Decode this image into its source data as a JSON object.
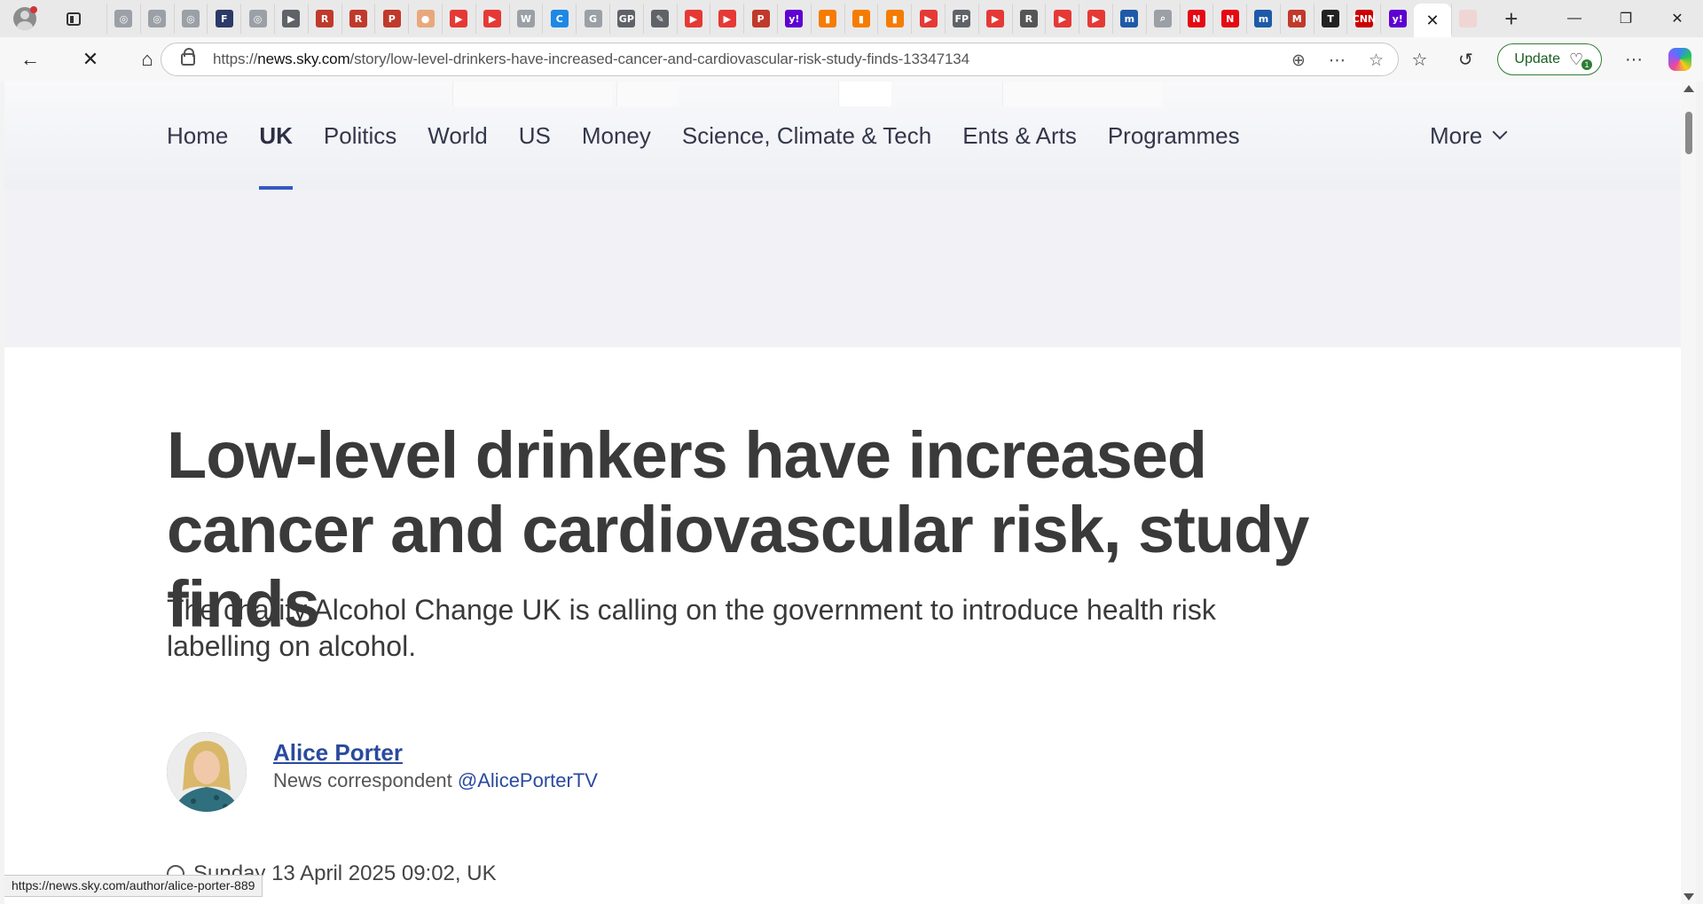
{
  "browser": {
    "url_prefix": "https://",
    "url_domain": "news.sky.com",
    "url_path": "/story/low-level-drinkers-have-increased-cancer-and-cardiovascular-risk-study-finds-13347134",
    "update_label": "Update",
    "update_badge": "1",
    "status_url": "https://news.sky.com/author/alice-porter-889",
    "tab_favicons": [
      {
        "icon": "globe-icon",
        "color": "#9aa0a6",
        "glyph": "◎"
      },
      {
        "icon": "globe-icon",
        "color": "#9aa0a6",
        "glyph": "◎"
      },
      {
        "icon": "globe-icon",
        "color": "#9aa0a6",
        "glyph": "◎"
      },
      {
        "icon": "fox-news-icon",
        "color": "#2b3a67",
        "glyph": "F"
      },
      {
        "icon": "globe-icon",
        "color": "#9aa0a6",
        "glyph": "◎"
      },
      {
        "icon": "arrow-icon",
        "color": "#5f6368",
        "glyph": "▶"
      },
      {
        "icon": "r-icon",
        "color": "#c0392b",
        "glyph": "R"
      },
      {
        "icon": "r-icon",
        "color": "#c0392b",
        "glyph": "R"
      },
      {
        "icon": "pdf-icon",
        "color": "#c0392b",
        "glyph": "P"
      },
      {
        "icon": "circle-icon",
        "color": "#e8a87c",
        "glyph": "●"
      },
      {
        "icon": "youtube-icon",
        "color": "#e53935",
        "glyph": "▶"
      },
      {
        "icon": "youtube-icon",
        "color": "#e53935",
        "glyph": "▶"
      },
      {
        "icon": "w-icon",
        "color": "#9aa0a6",
        "glyph": "W"
      },
      {
        "icon": "c-icon",
        "color": "#1e88e5",
        "glyph": "C"
      },
      {
        "icon": "google-icon",
        "color": "#9aa0a6",
        "glyph": "G"
      },
      {
        "icon": "gp-icon",
        "color": "#5f6368",
        "glyph": "GP"
      },
      {
        "icon": "pen-icon",
        "color": "#5f6368",
        "glyph": "✎"
      },
      {
        "icon": "youtube-icon",
        "color": "#e53935",
        "glyph": "▶"
      },
      {
        "icon": "youtube-icon",
        "color": "#e53935",
        "glyph": "▶"
      },
      {
        "icon": "pdf-icon",
        "color": "#c0392b",
        "glyph": "P"
      },
      {
        "icon": "yahoo-icon",
        "color": "#5f01d1",
        "glyph": "y!"
      },
      {
        "icon": "bookmark-icon",
        "color": "#f57c00",
        "glyph": "▮"
      },
      {
        "icon": "bookmark-icon",
        "color": "#f57c00",
        "glyph": "▮"
      },
      {
        "icon": "bookmark-icon",
        "color": "#f57c00",
        "glyph": "▮"
      },
      {
        "icon": "youtube-icon",
        "color": "#e53935",
        "glyph": "▶"
      },
      {
        "icon": "fp-icon",
        "color": "#5f6368",
        "glyph": "FP"
      },
      {
        "icon": "youtube-icon",
        "color": "#e53935",
        "glyph": "▶"
      },
      {
        "icon": "r-icon",
        "color": "#555555",
        "glyph": "R"
      },
      {
        "icon": "youtube-icon",
        "color": "#e53935",
        "glyph": "▶"
      },
      {
        "icon": "youtube-icon",
        "color": "#e53935",
        "glyph": "▶"
      },
      {
        "icon": "m-icon",
        "color": "#1e5aa8",
        "glyph": "m"
      },
      {
        "icon": "search-icon",
        "color": "#9aa0a6",
        "glyph": "⌕"
      },
      {
        "icon": "netflix-icon",
        "color": "#e50914",
        "glyph": "N"
      },
      {
        "icon": "netflix-icon",
        "color": "#e50914",
        "glyph": "N"
      },
      {
        "icon": "m-icon",
        "color": "#1e5aa8",
        "glyph": "m"
      },
      {
        "icon": "m-icon",
        "color": "#c0392b",
        "glyph": "M"
      },
      {
        "icon": "nyt-icon",
        "color": "#222222",
        "glyph": "T"
      },
      {
        "icon": "cnn-icon",
        "color": "#cc0000",
        "glyph": "CNN"
      },
      {
        "icon": "yahoo-icon",
        "color": "#5f01d1",
        "glyph": "y!"
      }
    ]
  },
  "site": {
    "nav": [
      "Home",
      "UK",
      "Politics",
      "World",
      "US",
      "Money",
      "Science, Climate & Tech",
      "Ents & Arts",
      "Programmes"
    ],
    "active_nav": "UK",
    "more_label": "More",
    "accent": "#3458c5"
  },
  "article": {
    "headline": "Low-level drinkers have increased cancer and cardiovascular risk, study finds",
    "standfirst": "The charity Alcohol Change UK is calling on the government to introduce health risk labelling on alcohol.",
    "author_name": "Alice Porter",
    "author_role": "News correspondent",
    "author_handle": "@AlicePorterTV",
    "datetime": "Sunday 13 April 2025 09:02, UK"
  }
}
